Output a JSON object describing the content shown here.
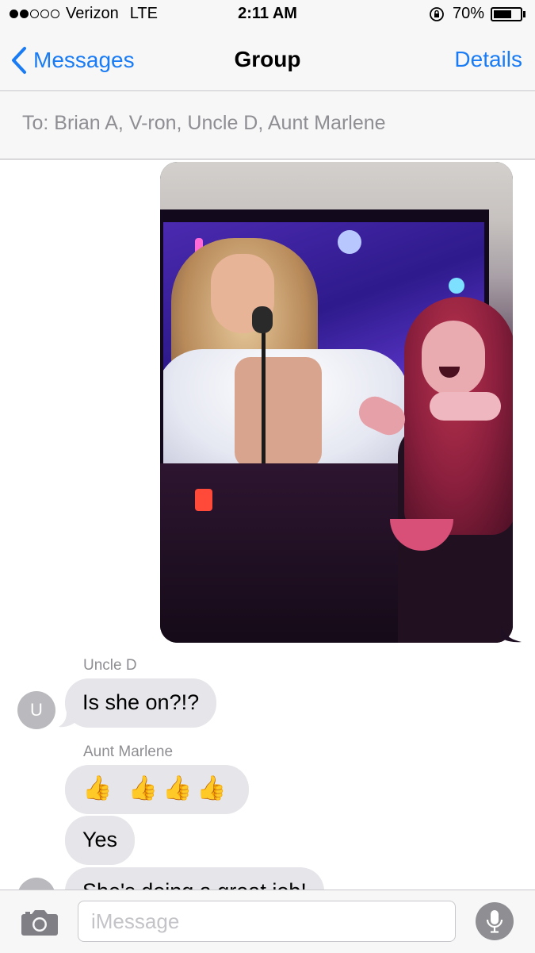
{
  "status_bar": {
    "carrier": "Verizon",
    "network": "LTE",
    "time": "2:11 AM",
    "battery_percent": "70%",
    "battery_level": 0.7,
    "signal_bars_filled": 2,
    "signal_bars_total": 5
  },
  "nav": {
    "back_label": "Messages",
    "title": "Group",
    "details_label": "Details"
  },
  "to_bar": {
    "text": "To: Brian A, V-ron, Uncle D, Aunt Marlene"
  },
  "messages": [
    {
      "sender": "Uncle D",
      "avatar_initial": "U",
      "text": "Is she on?!?"
    },
    {
      "sender": "Aunt Marlene",
      "text": "👍 👍👍👍"
    },
    {
      "text": "Yes"
    },
    {
      "text": "She's doing a great job!"
    }
  ],
  "input": {
    "placeholder": "iMessage"
  },
  "icons": {
    "back": "chevron-left-icon",
    "camera": "camera-icon",
    "mic": "microphone-icon",
    "lock": "orientation-lock-icon",
    "battery": "battery-icon"
  },
  "colors": {
    "accent": "#1a7cf5",
    "bubble_gray": "#e5e5ea",
    "bar_bg": "#f7f7f8"
  }
}
